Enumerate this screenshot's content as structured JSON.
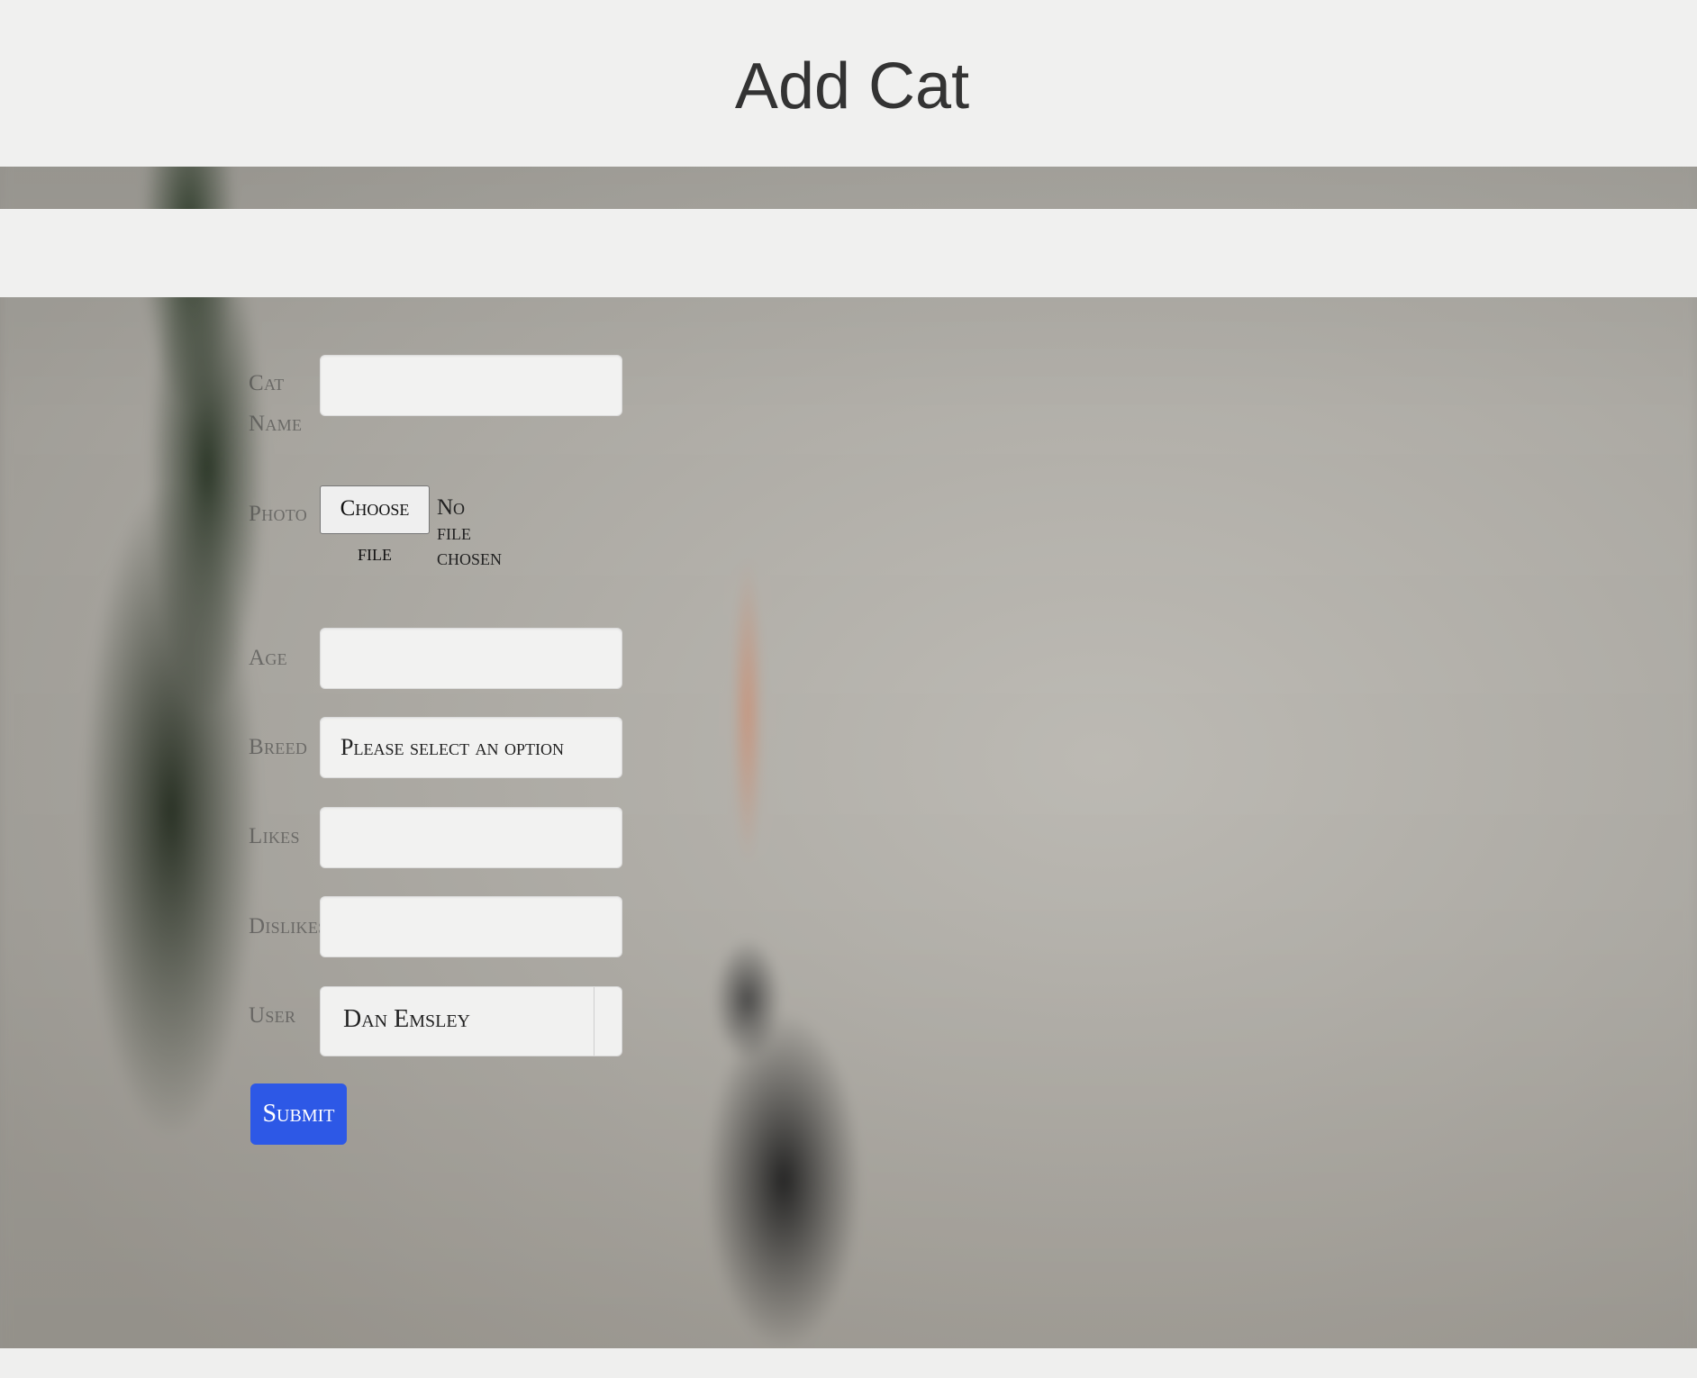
{
  "header": {
    "title": "Add Cat"
  },
  "form": {
    "fields": {
      "cat_name": {
        "label_line1": "Cat",
        "label_line2": "Name",
        "value": ""
      },
      "photo": {
        "label": "Photo",
        "button_label": "Choose file",
        "status": "No file chosen"
      },
      "age": {
        "label": "Age",
        "value": ""
      },
      "breed": {
        "label": "Breed",
        "selected": "Please select an option"
      },
      "likes": {
        "label": "Likes",
        "value": ""
      },
      "dislikes": {
        "label": "Dislikes",
        "value": ""
      },
      "user": {
        "label": "User",
        "selected": "Dan Emsley"
      }
    },
    "submit_label": "Submit"
  },
  "colors": {
    "submit_button": "#2d58e6",
    "header_bg": "#f0f0ef"
  }
}
